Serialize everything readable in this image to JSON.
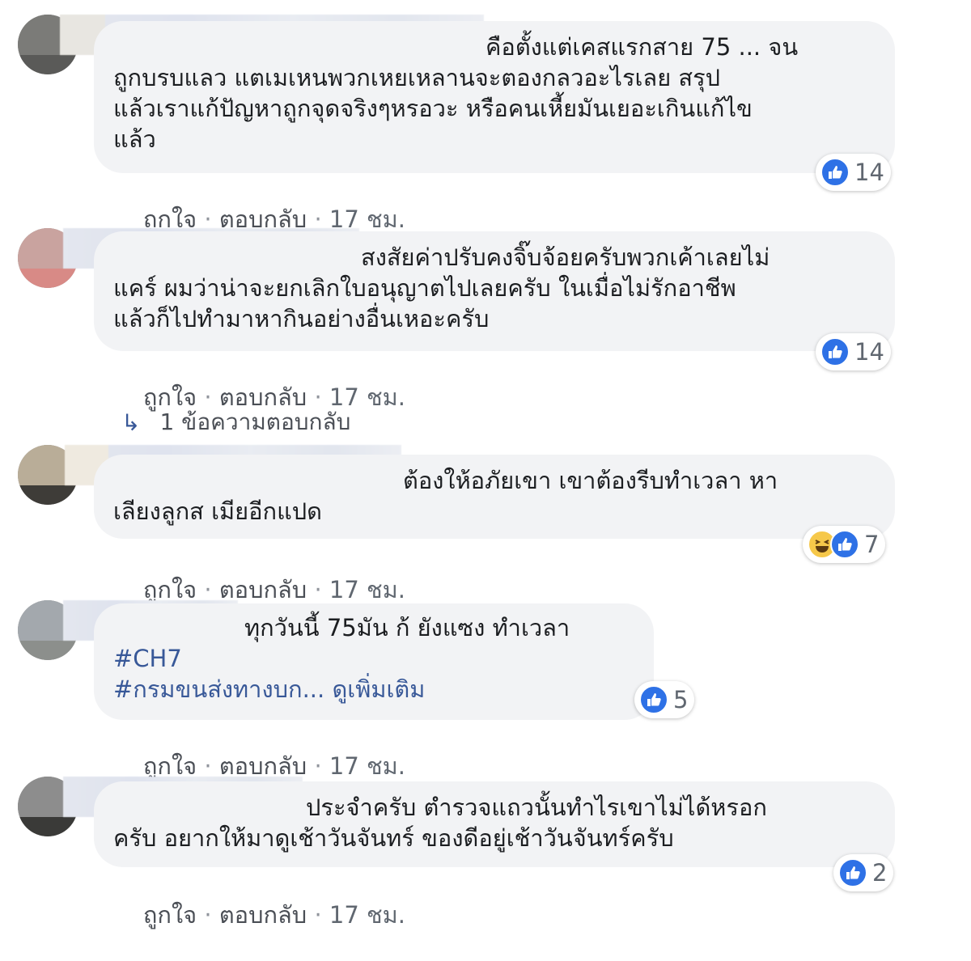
{
  "ui": {
    "like_label": "ถูกใจ",
    "reply_label": "ตอบกลับ",
    "dot": "·",
    "accent": "#2e71e6",
    "bubble_bg": "#f2f3f5",
    "link_color": "#385898"
  },
  "comments": [
    {
      "lines": [
        "คือตั้งแต่เคสแรกสาย 75 ... จน",
        "ถูกบรบแลว แตเมเหนพวกเหยเหลานจะตองกลวอะไรเลย สรุป",
        "แล้วเราแก้ปัญหาถูกจุดจริงๆหรอวะ หรือคนเหี้ยมันเยอะเกินแก้ไข",
        "แล้ว"
      ],
      "reaction_count": "14",
      "time": "17 ชม."
    },
    {
      "lines": [
        "สงสัยค่าปรับคงจิ๊บจ้อยครับพวกเค้าเลยไม่",
        "แคร์ ผมว่าน่าจะยกเลิกใบอนุญาตไปเลยครับ ในเมื่อไม่รักอาชีพ",
        "แล้วก็ไปทำมาหากินอย่างอื่นเหอะครับ"
      ],
      "reaction_count": "14",
      "time": "17 ชม.",
      "replies_label": "1 ข้อความตอบกลับ"
    },
    {
      "lines": [
        "ต้องให้อภัยเขา เขาต้องรีบทำเวลา หา",
        "เลียงลูกส เมียอีกแปด"
      ],
      "reaction_count": "7",
      "time": "17 ชม."
    },
    {
      "lines": [
        "ทุกวันนี้ 75มัน ก้ ยังแซง ทำเวลา"
      ],
      "tags": [
        "#CH7",
        "#กรมขนส่งทางบก..."
      ],
      "see_more": "ดูเพิ่มเติม",
      "reaction_count": "5",
      "time": "17 ชม."
    },
    {
      "lines": [
        "ประจำครับ ตำรวจแถวนั้นทำไรเขาไม่ได้หรอก",
        "ครับ อยากให้มาดูเช้าวันจันทร์ ของดีอยู่เช้าวันจันทร์ครับ"
      ],
      "reaction_count": "2",
      "time": "17 ชม."
    }
  ]
}
